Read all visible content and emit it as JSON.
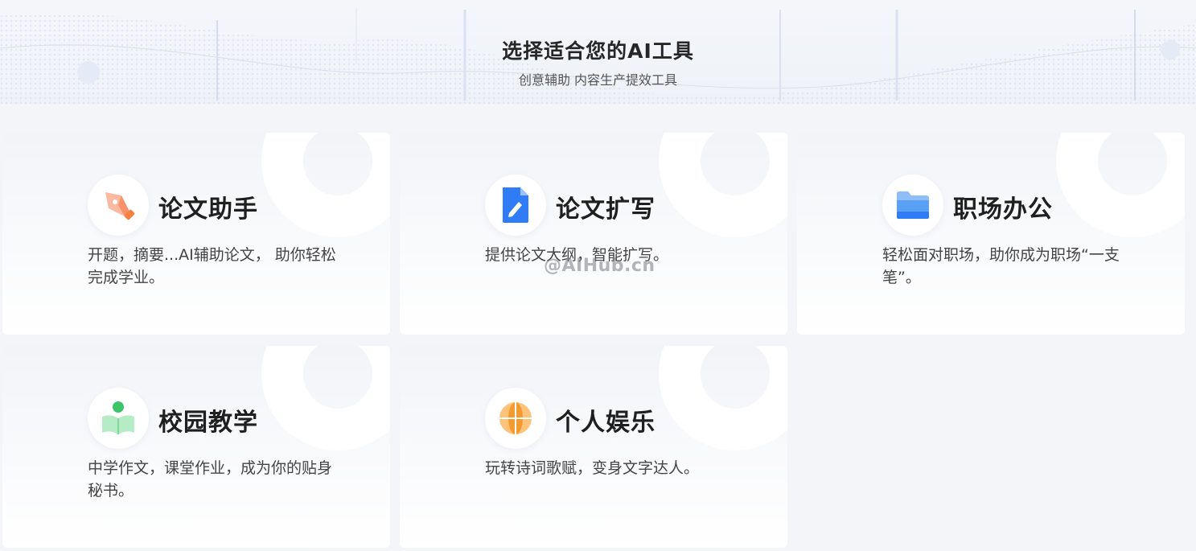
{
  "header": {
    "title": "选择适合您的AI工具",
    "subtitle": "创意辅助 内容生产提效工具"
  },
  "cards": [
    {
      "title": "论文助手",
      "desc": "开题，摘要...AI辅助论文， 助你轻松完成学业。",
      "icon": "pen-nib-icon"
    },
    {
      "title": "论文扩写",
      "desc": "提供论文大纲，智能扩写。",
      "icon": "document-edit-icon"
    },
    {
      "title": "职场办公",
      "desc": "轻松面对职场，助你成为职场“一支笔”。",
      "icon": "folder-icon"
    },
    {
      "title": "校园教学",
      "desc": "中学作文，课堂作业，成为你的贴身秘书。",
      "icon": "reading-student-icon"
    },
    {
      "title": "个人娱乐",
      "desc": "玩转诗词歌赋，变身文字达人。",
      "icon": "globe-icon"
    }
  ],
  "watermark": "@AIHub.cn",
  "colors": {
    "background": "#f3f5f9",
    "card_gradient_top": "#f2f4f8",
    "card_gradient_bottom": "#ffffff",
    "accent_blue": "#2f7cf6",
    "accent_orange": "#f5813f",
    "accent_green": "#3cc56a"
  }
}
